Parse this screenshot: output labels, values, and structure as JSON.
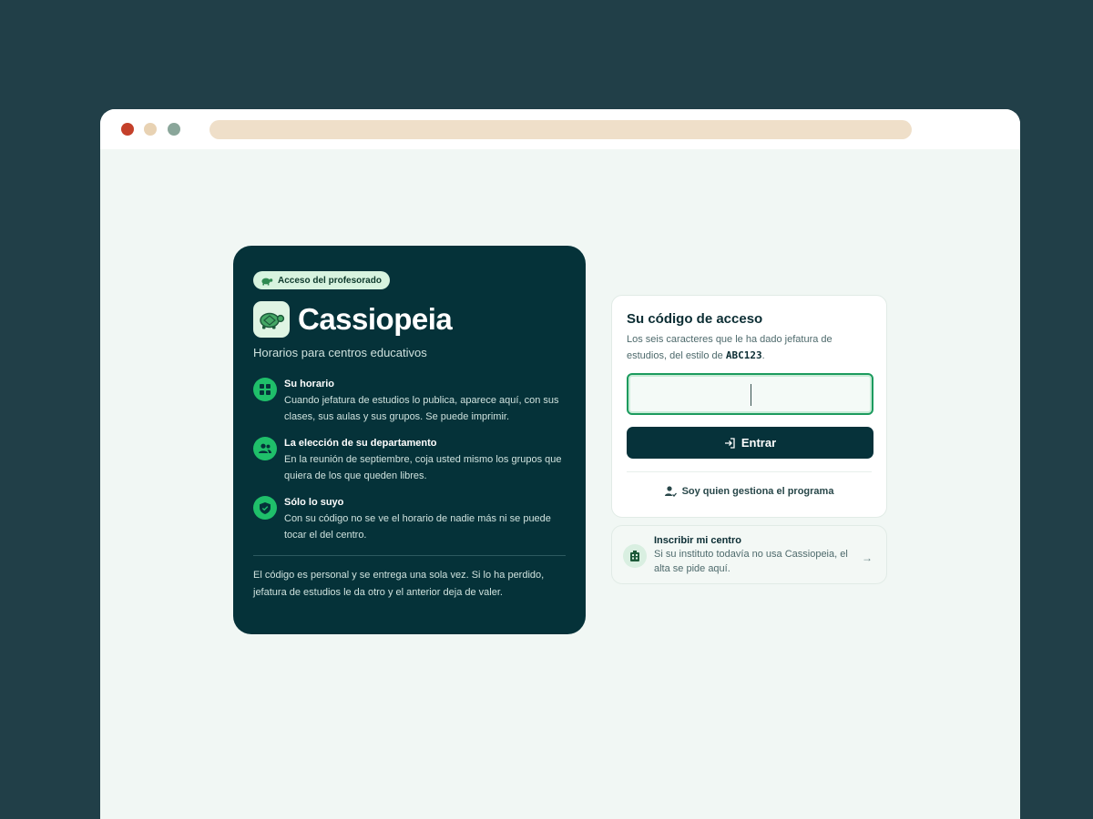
{
  "hero": {
    "badge": "Acceso del profesorado",
    "brand": "Cassiopeia",
    "tagline": "Horarios para centros educativos",
    "features": [
      {
        "title": "Su horario",
        "text": "Cuando jefatura de estudios lo publica, aparece aquí, con sus clases, sus aulas y sus grupos. Se puede imprimir.",
        "icon": "grid-icon"
      },
      {
        "title": "La elección de su departamento",
        "text": "En la reunión de septiembre, coja usted mismo los grupos que quiera de los que queden libres.",
        "icon": "people-icon"
      },
      {
        "title": "Sólo lo suyo",
        "text": "Con su código no se ve el horario de nadie más ni se puede tocar el del centro.",
        "icon": "shield-check-icon"
      }
    ],
    "note": "El código es personal y se entrega una sola vez. Si lo ha perdido, jefatura de estudios le da otro y el anterior deja de valer."
  },
  "login": {
    "title": "Su código de acceso",
    "subtitle_before": "Los seis caracteres que le ha dado jefatura de estudios, del estilo de ",
    "subtitle_code": "ABC123",
    "subtitle_after": ".",
    "code_value": "",
    "enter_label": "Entrar",
    "admin_label": "Soy quien gestiona el programa"
  },
  "register": {
    "title": "Inscribir mi centro",
    "text": "Si su instituto todavía no usa Cassiopeia, el alta se pide aquí.",
    "arrow": "→"
  },
  "colors": {
    "page_bg": "#213f48",
    "hero_bg": "#053239",
    "accent_green": "#1fbf6a",
    "button_bg": "#06323a"
  }
}
